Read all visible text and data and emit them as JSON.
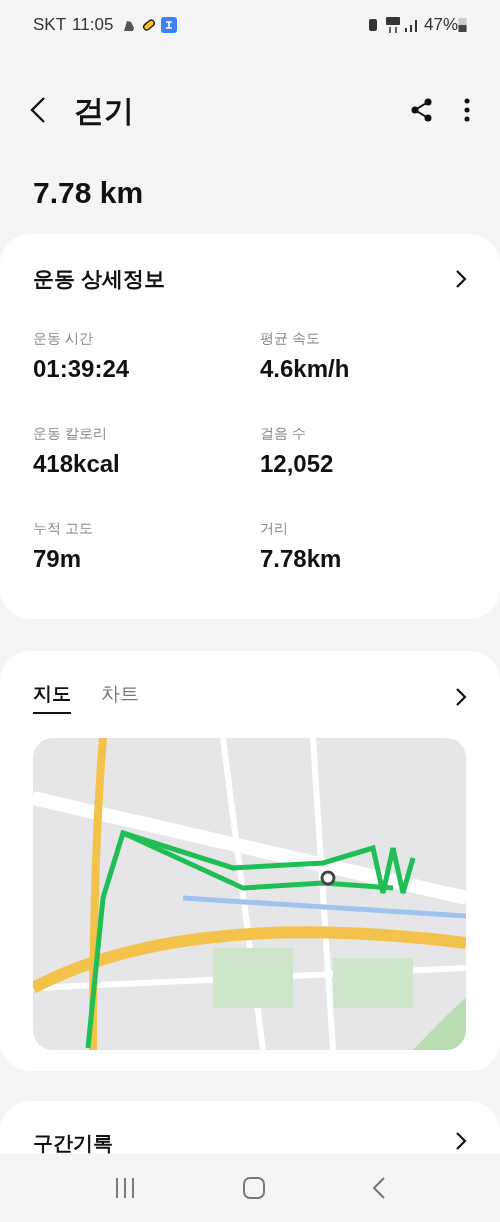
{
  "status_bar": {
    "carrier": "SKT",
    "time": "11:05",
    "battery": "47%"
  },
  "header": {
    "title": "걷기"
  },
  "distance": "7.78 km",
  "details": {
    "title": "운동 상세정보",
    "stats": [
      {
        "label": "운동 시간",
        "value": "01:39:24"
      },
      {
        "label": "평균 속도",
        "value": "4.6km/h"
      },
      {
        "label": "운동 칼로리",
        "value": "418kcal"
      },
      {
        "label": "걸음 수",
        "value": "12,052"
      },
      {
        "label": "누적 고도",
        "value": "79m"
      },
      {
        "label": "거리",
        "value": "7.78km"
      }
    ]
  },
  "map_card": {
    "tabs": [
      {
        "label": "지도",
        "selected": true
      },
      {
        "label": "차트",
        "selected": false
      }
    ]
  },
  "sections": [
    {
      "title": "구간기록"
    }
  ]
}
